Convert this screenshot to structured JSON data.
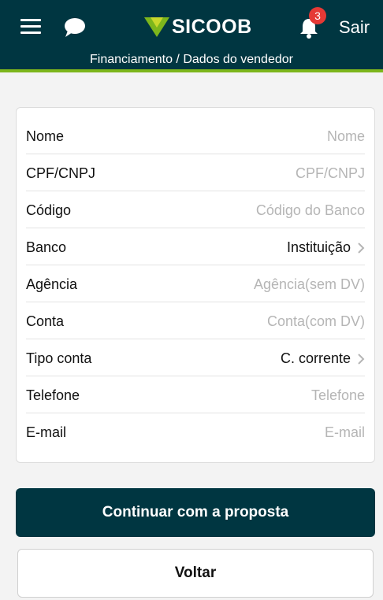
{
  "header": {
    "logo_text": "SICOOB",
    "notification_count": "3",
    "logout_label": "Sair"
  },
  "breadcrumb": "Financiamento / Dados do vendedor",
  "form": {
    "nome": {
      "label": "Nome",
      "placeholder": "Nome"
    },
    "cpf": {
      "label": "CPF/CNPJ",
      "placeholder": "CPF/CNPJ"
    },
    "codigo": {
      "label": "Código",
      "placeholder": "Código do Banco"
    },
    "banco": {
      "label": "Banco",
      "value": "Instituição"
    },
    "agencia": {
      "label": "Agência",
      "placeholder": "Agência(sem DV)"
    },
    "conta": {
      "label": "Conta",
      "placeholder": "Conta(com DV)"
    },
    "tipo_conta": {
      "label": "Tipo conta",
      "value": "C. corrente"
    },
    "telefone": {
      "label": "Telefone",
      "placeholder": "Telefone"
    },
    "email": {
      "label": "E-mail",
      "placeholder": "E-mail"
    }
  },
  "buttons": {
    "continue": "Continuar com a proposta",
    "back": "Voltar"
  },
  "colors": {
    "header_bg": "#003641",
    "accent_green": "#7db61c",
    "badge_red": "#e53935"
  },
  "icons": [
    "menu-icon",
    "chat-icon",
    "logo-mark-icon",
    "bell-icon",
    "chevron-right-icon"
  ]
}
